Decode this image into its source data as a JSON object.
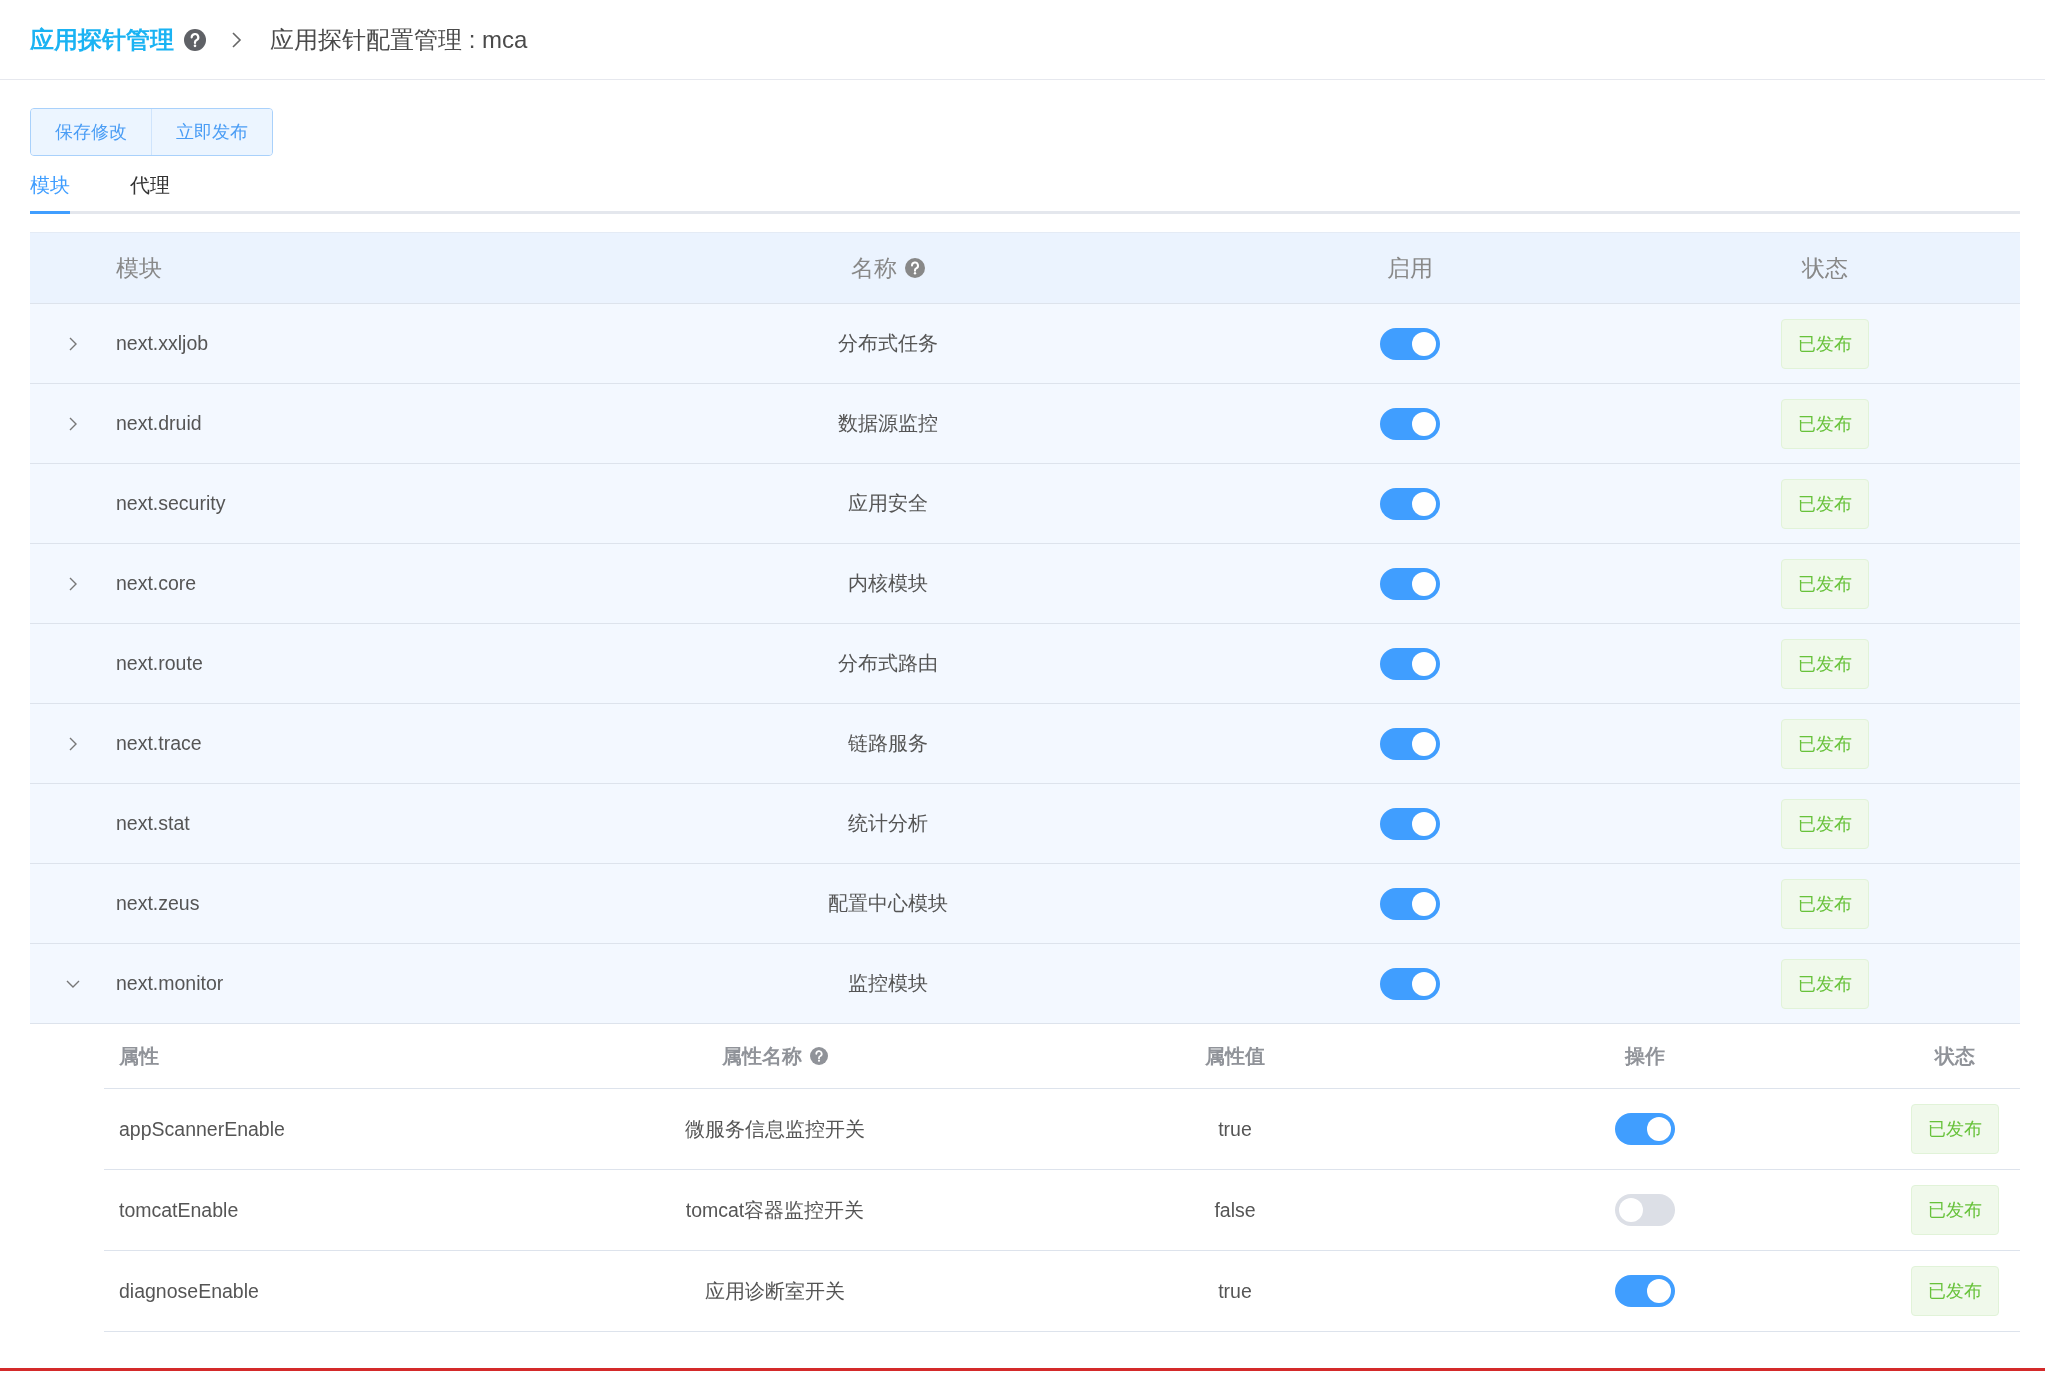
{
  "breadcrumb": {
    "title": "应用探针管理",
    "current": "应用探针配置管理 : mca"
  },
  "buttons": [
    "保存修改",
    "立即发布"
  ],
  "tabs": [
    {
      "label": "模块",
      "selected": true
    },
    {
      "label": "代理",
      "selected": false
    }
  ],
  "table": {
    "columns": [
      {
        "label": "模块"
      },
      {
        "label": "名称",
        "help": true
      },
      {
        "label": "启用"
      },
      {
        "label": "状态"
      }
    ],
    "rows": [
      {
        "module": "next.xxljob",
        "name": "分布式任务",
        "enabled": true,
        "status": "已发布",
        "expanded": false
      },
      {
        "module": "next.druid",
        "name": "数据源监控",
        "enabled": true,
        "status": "已发布",
        "expanded": false
      },
      {
        "module": "next.security",
        "name": "应用安全",
        "enabled": true,
        "status": "已发布"
      },
      {
        "module": "next.core",
        "name": "内核模块",
        "enabled": true,
        "status": "已发布",
        "expanded": false
      },
      {
        "module": "next.route",
        "name": "分布式路由",
        "enabled": true,
        "status": "已发布"
      },
      {
        "module": "next.trace",
        "name": "链路服务",
        "enabled": true,
        "status": "已发布",
        "expanded": false
      },
      {
        "module": "next.stat",
        "name": "统计分析",
        "enabled": true,
        "status": "已发布"
      },
      {
        "module": "next.zeus",
        "name": "配置中心模块",
        "enabled": true,
        "status": "已发布"
      },
      {
        "module": "next.monitor",
        "name": "监控模块",
        "enabled": true,
        "status": "已发布",
        "expanded": true,
        "properties": {
          "columns": [
            {
              "label": "属性"
            },
            {
              "label": "属性名称",
              "help": true
            },
            {
              "label": "属性值"
            },
            {
              "label": "操作"
            },
            {
              "label": "状态"
            }
          ],
          "rows": [
            {
              "key": "appScannerEnable",
              "name": "微服务信息监控开关",
              "value": "true",
              "on": true,
              "status": "已发布"
            },
            {
              "key": "tomcatEnable",
              "name": "tomcat容器监控开关",
              "value": "false",
              "on": false,
              "status": "已发布"
            },
            {
              "key": "diagnoseEnable",
              "name": "应用诊断室开关",
              "value": "true",
              "on": true,
              "status": "已发布"
            }
          ]
        }
      }
    ]
  }
}
